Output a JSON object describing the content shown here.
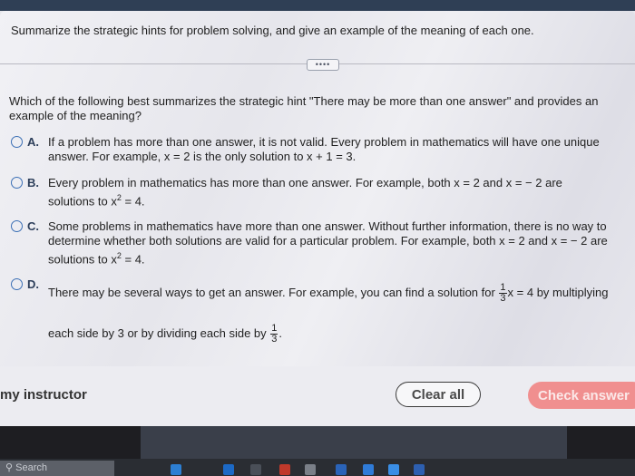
{
  "header": {
    "prompt": "Summarize the strategic hints for problem solving, and give an example of the meaning of each one."
  },
  "more_button": "••••",
  "question": "Which of the following best summarizes the strategic hint \"There may be more than one answer\" and provides an example of the meaning?",
  "options": [
    {
      "letter": "A.",
      "l1": "If a problem has more than one answer, it is not valid. Every problem in mathematics will have one unique",
      "l2": "answer. For example, x = 2 is the only solution to x + 1 = 3."
    },
    {
      "letter": "B.",
      "l1": "Every problem in mathematics has more than one answer. For example, both x = 2 and  x = − 2 are",
      "l2a": "solutions to x",
      "l2sup": "2",
      "l2b": " = 4."
    },
    {
      "letter": "C.",
      "l1": "Some problems in mathematics have more than one answer. Without further information,  there is no way to",
      "l2": "determine whether both solutions are valid for a particular problem. For example, both x = 2 and x = − 2 are",
      "l3a": "solutions to x",
      "l3sup": "2",
      "l3b": " = 4."
    },
    {
      "letter": "D.",
      "l1a": "There may be several ways to get an answer. For example, you can find a solution for ",
      "l1num": "1",
      "l1den": "3",
      "l1b": "x = 4 by multiplying",
      "l2a": "each side by 3 or by dividing each side by ",
      "l2num": "1",
      "l2den": "3",
      "l2b": "."
    }
  ],
  "footer": {
    "instructor": "my instructor",
    "clear_all": "Clear all",
    "check_answer": "Check answer"
  },
  "taskbar": {
    "search": "Search"
  }
}
